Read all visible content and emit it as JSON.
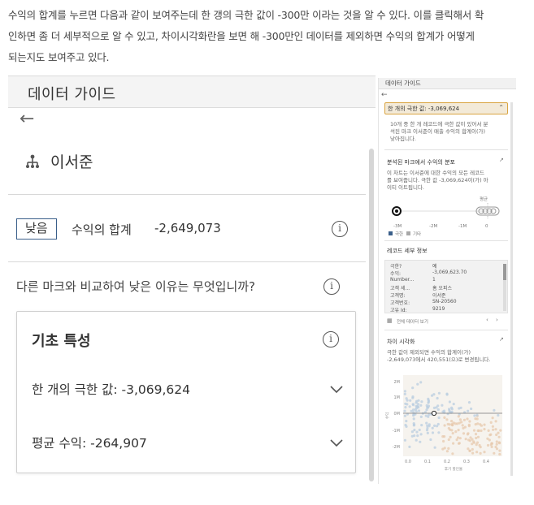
{
  "intro": {
    "line1": "수익의 합계를 누르면 다음과 같이 보여주는데 한 갱의 극한 값이 -300만 이라는 것을 알 수 있다. 이를 클릭해서 확",
    "line2": "인하면 좀 더 세부적으로 알 수 있고, 차이시각화란을 보면 해 -300만인 데이터를 제외하면 수익의 합계가 어떻게",
    "line3": "되는지도 보여주고 있다."
  },
  "left_panel": {
    "title": "데이터 가이드",
    "back_icon": "arrow-left-icon",
    "person_icon": "hierarchy-icon",
    "person_name": "이서준",
    "badge": "낮음",
    "metric_label": "수익의 합계",
    "metric_value": "-2,649,073",
    "question": "다른 마크와 비교하여 낮은 이유는 무엇입니까?",
    "card": {
      "title": "기초 특성",
      "rows": [
        {
          "label": "한 개의 극한 값: -3,069,624"
        },
        {
          "label": "평균 수익: -264,907"
        }
      ]
    },
    "colors": {
      "badge_border": "#3a5f8a",
      "header_bg": "#f4f4f4"
    }
  },
  "right_panel": {
    "title": "데이터 가이드",
    "selected": "한 개의 극한 값: -3,069,624",
    "desc1": "10개 중 한 개 레코드에 극한 값이 있어서 분",
    "desc2": "석된 마크 이서준이 매출 수익의 합계이(가)",
    "desc3": "낮아집니다.",
    "dist_heading": "분석된 마크에서 수익의 분포",
    "dist1": "이 차트는 이서준에 대한 수익의 모든 레코드",
    "dist2": "를 보여줍니다. 극한 값 -3,069,624이(가) 아",
    "dist3": "이티 이트됩니다.",
    "dist_avg_label": "평균",
    "dist_ticks": [
      "-3M",
      "-2M",
      "-1M",
      "0"
    ],
    "legend_extreme": "극한",
    "legend_other": "기타",
    "record_heading": "레코드 세부 정보",
    "records": [
      {
        "k": "극한?",
        "v": "예"
      },
      {
        "k": "수익:",
        "v": "-3,069,623.70"
      },
      {
        "k": "Number...",
        "v": "1"
      },
      {
        "k": "고객 세...",
        "v": "홈 오피스"
      },
      {
        "k": "고객명:",
        "v": "이서준"
      },
      {
        "k": "고객번호:",
        "v": "SN-20560"
      },
      {
        "k": "고유 Id:",
        "v": "9219"
      }
    ],
    "view_all": "전체 데이터 보기",
    "diff_heading": "차이 시각화",
    "diff1": "극한 값이 제외되면 수익의 합계이(가)",
    "diff2": "-2,649,073에서 420,551(으)로 변경됩니다.",
    "scatter_y_ticks": [
      "2M",
      "1M",
      "0M",
      "-1M",
      "-2M"
    ],
    "scatter_x_ticks": [
      "0.0",
      "0.1",
      "0.2",
      "0.3",
      "0.4"
    ],
    "scatter_xlabel": "후기 할인율",
    "scatter_ylabel": "수익",
    "colors": {
      "selected_border": "#d9a441",
      "selected_bg": "#f3ead8",
      "extreme": "#3b5f8a",
      "other": "#a8a8a8"
    }
  }
}
